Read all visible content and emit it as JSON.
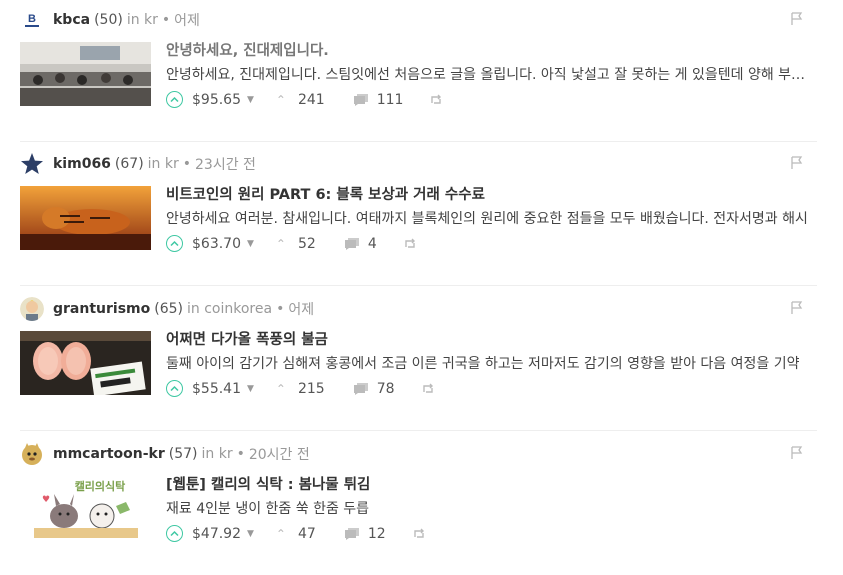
{
  "accent": "#3fc8a3",
  "posts": [
    {
      "author": "kbca",
      "reputation": "(50)",
      "in": "in kr",
      "time": "어제",
      "title": "안녕하세요, 진대제입니다.",
      "excerpt": "안녕하세요, 진대제입니다. 스팀잇에선 처음으로 글을 올립니다. 아직 낯설고 잘 못하는 게 있을텐데 양해 부탁드립니다.",
      "payout": "$95.65",
      "votes": "241",
      "comments": "111",
      "avatar": "kbca-logo"
    },
    {
      "author": "kim066",
      "reputation": "(67)",
      "in": "in kr",
      "time": "23시간 전",
      "title": "비트코인의 원리 PART 6: 블록 보상과 거래 수수료",
      "excerpt": "안녕하세요 여러분. 참새입니다. 여태까지 블록체인의 원리에 중요한 점들을 모두 배웠습니다. 전자서명과 해시",
      "payout": "$63.70",
      "votes": "52",
      "comments": "4",
      "avatar": "star"
    },
    {
      "author": "granturismo",
      "reputation": "(65)",
      "in": "in coinkorea",
      "time": "어제",
      "title": "어쩌면 다가올 폭풍의 불금",
      "excerpt": "둘째 아이의 감기가 심해져 홍콩에서 조금 이른 귀국을 하고는 저마저도 감기의 영향을 받아 다음 여정을 기약",
      "payout": "$55.41",
      "votes": "215",
      "comments": "78",
      "avatar": "person"
    },
    {
      "author": "mmcartoon-kr",
      "reputation": "(57)",
      "in": "in kr",
      "time": "20시간 전",
      "title": "[웹툰] 캘리의 식탁 : 봄나물 튀김",
      "excerpt": "재료 4인분 냉이 한줌 쑥 한줌 두릅",
      "payout": "$47.92",
      "votes": "47",
      "comments": "12",
      "avatar": "cartoon"
    }
  ]
}
